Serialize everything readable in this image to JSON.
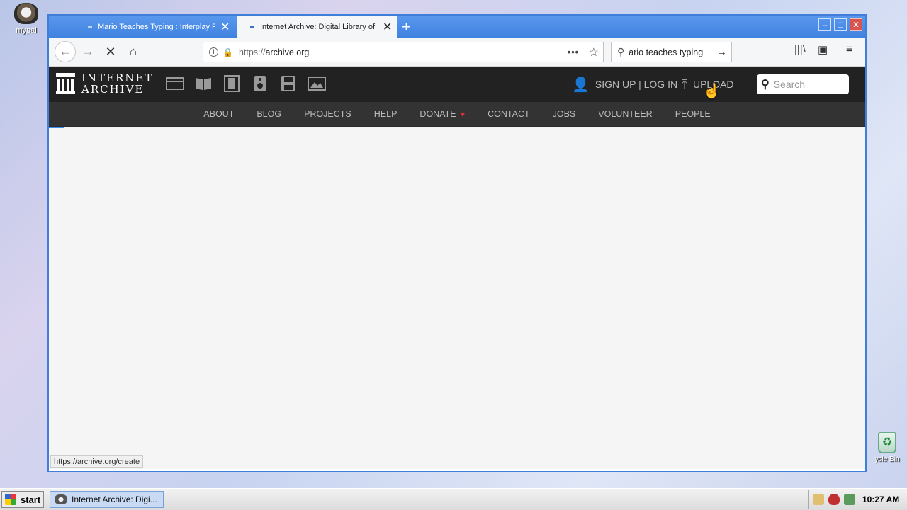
{
  "desktop": {
    "icons": [
      {
        "label": "mypal"
      },
      {
        "label": "ycle Bin"
      }
    ]
  },
  "browser": {
    "tabs": [
      {
        "title": "Mario Teaches Typing : Interplay Pr",
        "active": false
      },
      {
        "title": "Internet Archive: Digital Library of",
        "active": true
      }
    ],
    "url_protocol": "https://",
    "url_host": "archive.org",
    "search_value": "ario teaches typing",
    "status_text": "https://archive.org/create"
  },
  "ia": {
    "logo_line1": "INTERNET",
    "logo_line2": "ARCHIVE",
    "media_icons": [
      "web-icon",
      "texts-icon",
      "video-icon",
      "audio-icon",
      "software-icon",
      "images-icon"
    ],
    "signup_login": "SIGN UP | LOG IN",
    "upload": "UPLOAD",
    "search_placeholder": "Search",
    "nav": [
      "ABOUT",
      "BLOG",
      "PROJECTS",
      "HELP",
      "DONATE",
      "CONTACT",
      "JOBS",
      "VOLUNTEER",
      "PEOPLE"
    ],
    "donate_heart_color": "#e03030"
  },
  "taskbar": {
    "start_label": "start",
    "task_label": "Internet Archive: Digi...",
    "clock": "10:27 AM"
  }
}
